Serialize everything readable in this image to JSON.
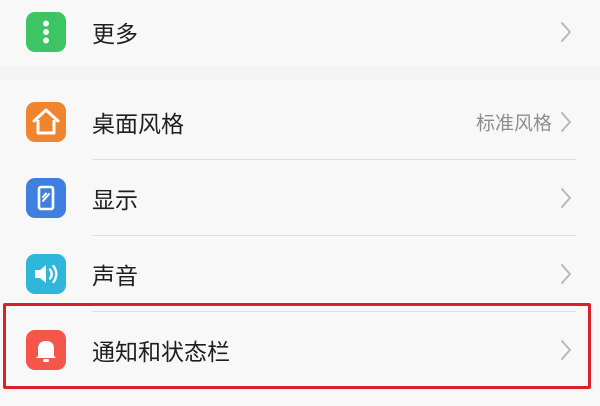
{
  "settings": {
    "more": {
      "label": "更多",
      "icon": "more-dots-icon",
      "color": "#3ec563"
    },
    "items": [
      {
        "label": "桌面风格",
        "value": "标准风格",
        "icon": "home-icon",
        "color": "#f0852e"
      },
      {
        "label": "显示",
        "value": "",
        "icon": "display-phone-icon",
        "color": "#3f7fe0"
      },
      {
        "label": "声音",
        "value": "",
        "icon": "speaker-icon",
        "color": "#2fb7db"
      },
      {
        "label": "通知和状态栏",
        "value": "",
        "icon": "bell-icon",
        "color": "#f4564a"
      }
    ]
  },
  "highlight_color": "#d9202c"
}
